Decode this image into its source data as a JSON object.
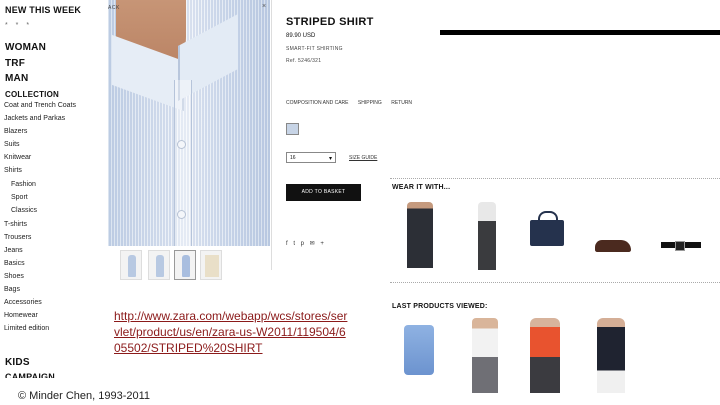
{
  "nav": {
    "new_this_week": "NEW THIS WEEK",
    "stars": "* * *",
    "woman": "WOMAN",
    "trf": "TRF",
    "man": "MAN",
    "collection": "COLLECTION",
    "items": [
      "Coat and Trench Coats",
      "Jackets and Parkas",
      "Blazers",
      "Suits",
      "Knitwear",
      "Shirts"
    ],
    "shirt_sub": [
      "Fashion",
      "Sport",
      "Classics"
    ],
    "items2": [
      "T-shirts",
      "Trousers",
      "Jeans",
      "Basics",
      "Shoes",
      "Bags",
      "Accessories",
      "Homewear",
      "Limited edition"
    ],
    "kids": "KIDS",
    "campaign": "CAMPAIGN"
  },
  "photo": {
    "back_label": "ACK",
    "close": "×"
  },
  "product": {
    "title": "STRIPED SHIRT",
    "price": "89.90 USD",
    "category": "SMART-FIT SHIRTING",
    "ref": "Ref. 5246/321",
    "tabs": [
      "COMPOSITION AND CARE",
      "SHIPPING",
      "RETURN"
    ],
    "size_value": "16",
    "size_guide": "SIZE GUIDE",
    "add_to_basket": "ADD TO BASKET",
    "share_icons": "f t p ✉ +"
  },
  "wear_it_with": {
    "title": "WEAR IT WITH..."
  },
  "last_viewed": {
    "title": "LAST PRODUCTS VIEWED:"
  },
  "url": "http://www.zara.com/webapp/wcs/stores/servlet/product/us/en/zara-us-W2011/119504/605502/STRIPED%20SHIRT",
  "footer": "© Minder Chen, 1993-2011",
  "colors": {
    "accent_bar": "#000000",
    "url_color": "#8b1a1a",
    "swatch": "#c7d4e6"
  }
}
